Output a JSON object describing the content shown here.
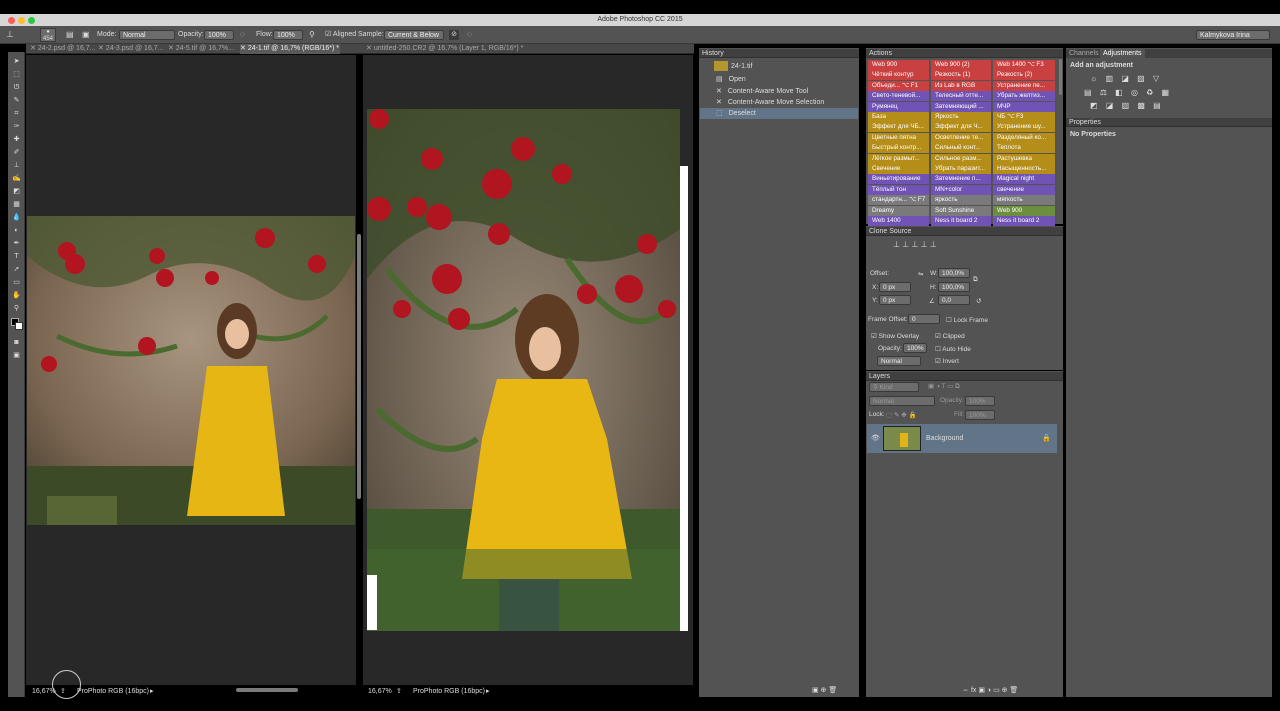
{
  "window": {
    "title": "Adobe Photoshop CC 2015",
    "user": "Kalmykova Irina"
  },
  "colors": {
    "red": "#c94040",
    "yellow": "#b58d19",
    "purple": "#7053b5",
    "grey": "#7a7a7a",
    "green": "#6b8f3f"
  },
  "options": {
    "brush_size": "454",
    "mode_label": "Mode:",
    "mode_value": "Normal",
    "opacity_label": "Opacity:",
    "opacity_value": "100%",
    "flow_label": "Flow:",
    "flow_value": "100%",
    "aligned_label": "Aligned",
    "sample_label": "Sample:",
    "sample_value": "Current & Below"
  },
  "doc_tabs": [
    "24-2.psd @ 16,7...",
    "24-3.psd @ 16,7...",
    "24-5.tif @ 16,7%...",
    "24-1.tif @ 16,7% (RGB/16*) *"
  ],
  "doc2_tab": "untitled-250.CR2 @ 16,7% (Layer 1, RGB/16*) *",
  "status_left": {
    "zoom": "16,67%",
    "profile": "ProPhoto RGB (16bpc)"
  },
  "status_right": {
    "zoom": "16,67%",
    "profile": "ProPhoto RGB (16bpc)"
  },
  "history": {
    "title": "History",
    "snapshot": "24-1.tif",
    "items": [
      "Open",
      "Content-Aware Move Tool",
      "Content-Aware Move Selection",
      "Deselect"
    ]
  },
  "actions": {
    "title": "Actions",
    "rows": [
      [
        [
          "Web 900",
          "red"
        ],
        [
          "Web 900 (2)",
          "red"
        ],
        [
          "Web 1400 ⌥ F3",
          "red"
        ]
      ],
      [
        [
          "Чёткий контур",
          "red"
        ],
        [
          "Резкость (1)",
          "red"
        ],
        [
          "Резкость (2)",
          "red"
        ]
      ],
      [
        [
          "Объеди... ⌥ F1",
          "red"
        ],
        [
          "Из Lab в RGB",
          "red"
        ],
        [
          "Устранение пе...",
          "red"
        ]
      ],
      [
        [
          "Свето-теневой...",
          "purple"
        ],
        [
          "Телесный отте...",
          "purple"
        ],
        [
          "Убрать желтиз...",
          "purple"
        ]
      ],
      [
        [
          "Румянец",
          "purple"
        ],
        [
          "Затемняющий ...",
          "purple"
        ],
        [
          "МЧР",
          "purple"
        ]
      ],
      [
        [
          "База",
          "yellow"
        ],
        [
          "Яркость",
          "yellow"
        ],
        [
          "ЧБ ⌥ F3",
          "yellow"
        ]
      ],
      [
        [
          "Эффект для ЧБ...",
          "yellow"
        ],
        [
          "Эффект для Ч...",
          "yellow"
        ],
        [
          "Устранение шу...",
          "yellow"
        ]
      ],
      [
        [
          "Цветные пятна",
          "yellow"
        ],
        [
          "Осветление те...",
          "yellow"
        ],
        [
          "Разделяный ко...",
          "yellow"
        ]
      ],
      [
        [
          "Быстрый контр...",
          "yellow"
        ],
        [
          "Сильный конт...",
          "yellow"
        ],
        [
          "Теплота",
          "yellow"
        ]
      ],
      [
        [
          "Лёгкое размыт...",
          "yellow"
        ],
        [
          "Сильное разм...",
          "yellow"
        ],
        [
          "Растушевка",
          "yellow"
        ]
      ],
      [
        [
          "Свечение",
          "yellow"
        ],
        [
          "Убрать паразит...",
          "yellow"
        ],
        [
          "Насыщенность...",
          "yellow"
        ]
      ],
      [
        [
          "Виньетирование",
          "purple"
        ],
        [
          "Затемнение п...",
          "purple"
        ],
        [
          "Magical night",
          "purple"
        ]
      ],
      [
        [
          "Тёплый тон",
          "purple"
        ],
        [
          "MN+color",
          "purple"
        ],
        [
          "свечение",
          "purple"
        ]
      ],
      [
        [
          "стандартн... ⌥ F7",
          "grey"
        ],
        [
          "яркость",
          "grey"
        ],
        [
          "мягкость",
          "grey"
        ]
      ],
      [
        [
          "Dreamy",
          "grey"
        ],
        [
          "Soft Sunshine",
          "grey"
        ],
        [
          "Web 900",
          "green"
        ]
      ],
      [
        [
          "Web 1400",
          "purple"
        ],
        [
          "Ness it board 2",
          "purple"
        ],
        [
          "Ness it board 2",
          "purple"
        ]
      ]
    ]
  },
  "clone_source": {
    "title": "Clone Source",
    "offset_label": "Offset:",
    "w_label": "W:",
    "w_value": "100,0%",
    "h_label": "H:",
    "h_value": "100,0%",
    "x_label": "X:",
    "x_value": "0 px",
    "y_label": "Y:",
    "y_value": "0 px",
    "angle_value": "0,0",
    "frame_offset_label": "Frame Offset:",
    "frame_offset_value": "0",
    "lock_frame_label": "Lock Frame",
    "show_overlay_label": "Show Overlay",
    "clipped_label": "Clipped",
    "opacity_label": "Opacity:",
    "opacity_value": "100%",
    "auto_hide_label": "Auto Hide",
    "blend_value": "Normal",
    "invert_label": "Invert"
  },
  "layers": {
    "title": "Layers",
    "kind": "Kind",
    "blend": "Normal",
    "opacity_label": "Opacity:",
    "opacity_value": "100%",
    "lock_label": "Lock:",
    "fill_label": "Fill:",
    "fill_value": "100%",
    "layer_name": "Background"
  },
  "right_panels": {
    "channels_tab": "Channels",
    "adjustments_tab": "Adjustments",
    "add_adjustment": "Add an adjustment",
    "properties_title": "Properties",
    "no_properties": "No Properties"
  }
}
